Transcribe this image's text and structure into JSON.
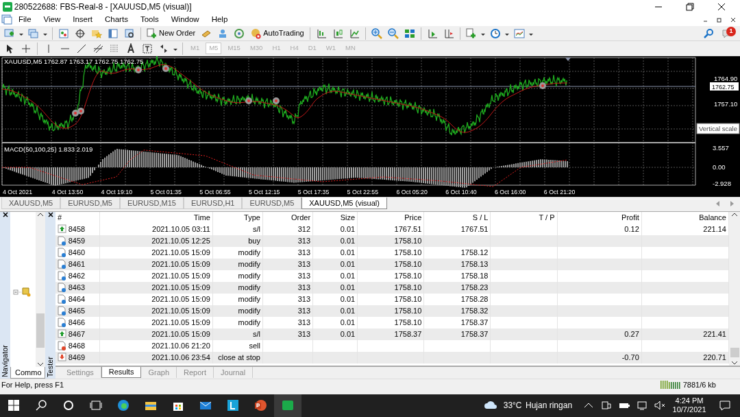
{
  "window": {
    "title": "280522688: FBS-Real-8 - [XAUUSD,M5 (visual)]"
  },
  "menu": [
    "File",
    "View",
    "Insert",
    "Charts",
    "Tools",
    "Window",
    "Help"
  ],
  "toolbar": {
    "new_order": "New Order",
    "auto_trading": "AutoTrading",
    "notifications": "1"
  },
  "timeframes": [
    {
      "label": "M1",
      "selected": false
    },
    {
      "label": "M5",
      "selected": true
    },
    {
      "label": "M15",
      "selected": false
    },
    {
      "label": "M30",
      "selected": false
    },
    {
      "label": "H1",
      "selected": false
    },
    {
      "label": "H4",
      "selected": false
    },
    {
      "label": "D1",
      "selected": false
    },
    {
      "label": "W1",
      "selected": false
    },
    {
      "label": "MN",
      "selected": false
    }
  ],
  "chart": {
    "info": "XAUUSD,M5  1762.87 1763.17 1762.75 1762.75",
    "price_labels": [
      "1764.90",
      "1757.10"
    ],
    "current_price": "1762.75",
    "tooltip": "Vertical scale",
    "macd_info": "MACD(50,100,25) 1.833 2.019",
    "macd_labels": [
      "3.557",
      "0.00",
      "-2.928"
    ],
    "time_labels": [
      "4 Oct 2021",
      "4 Oct 13:50",
      "4 Oct 19:10",
      "5 Oct 01:35",
      "5 Oct 06:55",
      "5 Oct 12:15",
      "5 Oct 17:35",
      "5 Oct 22:55",
      "6 Oct 05:20",
      "6 Oct 10:40",
      "6 Oct 16:00",
      "6 Oct 21:20"
    ]
  },
  "chart_tabs": [
    {
      "label": "XAUUSD,M5",
      "selected": false
    },
    {
      "label": "EURUSD,M5",
      "selected": false
    },
    {
      "label": "EURUSD,M15",
      "selected": false
    },
    {
      "label": "EURUSD,H1",
      "selected": false
    },
    {
      "label": "EURUSD,M5",
      "selected": false
    },
    {
      "label": "XAUUSD,M5 (visual)",
      "selected": true
    }
  ],
  "navigator": {
    "title": "Navigator",
    "tab": "Commo"
  },
  "tester": {
    "title": "Tester",
    "columns": [
      "#",
      "Time",
      "Type",
      "Order",
      "Size",
      "Price",
      "S / L",
      "T / P",
      "Profit",
      "Balance"
    ],
    "rows": [
      {
        "kind": "up",
        "number": "8458",
        "time": "2021.10.05 03:11",
        "type": "s/l",
        "order": "312",
        "size": "0.01",
        "price": "1767.51",
        "sl": "1767.51",
        "profit": "0.12",
        "balance": "221.14"
      },
      {
        "kind": "blue",
        "number": "8459",
        "time": "2021.10.05 12:25",
        "type": "buy",
        "order": "313",
        "size": "0.01",
        "price": "1758.10"
      },
      {
        "kind": "blue",
        "number": "8460",
        "time": "2021.10.05 15:09",
        "type": "modify",
        "order": "313",
        "size": "0.01",
        "price": "1758.10",
        "sl": "1758.12"
      },
      {
        "kind": "blue",
        "number": "8461",
        "time": "2021.10.05 15:09",
        "type": "modify",
        "order": "313",
        "size": "0.01",
        "price": "1758.10",
        "sl": "1758.13"
      },
      {
        "kind": "blue",
        "number": "8462",
        "time": "2021.10.05 15:09",
        "type": "modify",
        "order": "313",
        "size": "0.01",
        "price": "1758.10",
        "sl": "1758.18"
      },
      {
        "kind": "blue",
        "number": "8463",
        "time": "2021.10.05 15:09",
        "type": "modify",
        "order": "313",
        "size": "0.01",
        "price": "1758.10",
        "sl": "1758.23"
      },
      {
        "kind": "blue",
        "number": "8464",
        "time": "2021.10.05 15:09",
        "type": "modify",
        "order": "313",
        "size": "0.01",
        "price": "1758.10",
        "sl": "1758.28"
      },
      {
        "kind": "blue",
        "number": "8465",
        "time": "2021.10.05 15:09",
        "type": "modify",
        "order": "313",
        "size": "0.01",
        "price": "1758.10",
        "sl": "1758.32"
      },
      {
        "kind": "blue",
        "number": "8466",
        "time": "2021.10.05 15:09",
        "type": "modify",
        "order": "313",
        "size": "0.01",
        "price": "1758.10",
        "sl": "1758.37"
      },
      {
        "kind": "up",
        "number": "8467",
        "time": "2021.10.05 15:09",
        "type": "s/l",
        "order": "313",
        "size": "0.01",
        "price": "1758.37",
        "sl": "1758.37",
        "profit": "0.27",
        "balance": "221.41"
      },
      {
        "kind": "red",
        "number": "8468",
        "time": "2021.10.06 21:20",
        "type": "sell"
      },
      {
        "kind": "down",
        "number": "8469",
        "time": "2021.10.06 23:54",
        "type": "close at stop",
        "profit": "-0.70",
        "balance": "220.71"
      }
    ],
    "tabs": [
      {
        "label": "Settings",
        "selected": false
      },
      {
        "label": "Results",
        "selected": true
      },
      {
        "label": "Graph",
        "selected": false
      },
      {
        "label": "Report",
        "selected": false
      },
      {
        "label": "Journal",
        "selected": false
      }
    ]
  },
  "status_bar": {
    "help": "For Help, press F1",
    "traffic": "7881/6 kb"
  },
  "taskbar": {
    "temperature": "33°C",
    "weather": "Hujan ringan",
    "time": "4:24 PM",
    "date": "10/7/2021"
  }
}
